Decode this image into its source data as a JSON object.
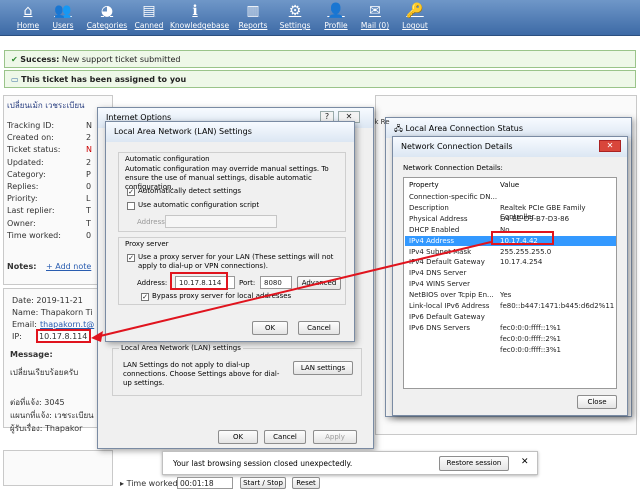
{
  "nav": [
    {
      "label": "Home",
      "icon": "home-icon",
      "glyph": "⌂"
    },
    {
      "label": "Users",
      "icon": "users-icon",
      "glyph": "👥"
    },
    {
      "label": "Categories",
      "icon": "categories-icon",
      "glyph": "◕"
    },
    {
      "label": "Canned",
      "icon": "canned-icon",
      "glyph": "▤"
    },
    {
      "label": "Knowledgebase",
      "icon": "knowledgebase-icon",
      "glyph": "ℹ"
    },
    {
      "label": "Reports",
      "icon": "reports-icon",
      "glyph": "▥"
    },
    {
      "label": "Settings",
      "icon": "settings-icon",
      "glyph": "⚙"
    },
    {
      "label": "Profile",
      "icon": "profile-icon",
      "glyph": "👤"
    },
    {
      "label": "Mail (0)",
      "icon": "mail-icon",
      "glyph": "✉"
    },
    {
      "label": "Logout",
      "icon": "logout-icon",
      "glyph": "🔑"
    }
  ],
  "success": {
    "prefix": "Success:",
    "text": "New support ticket submitted"
  },
  "assigned": "This ticket has been assigned to you",
  "ticket": {
    "subject": "เปลี่ยนเม้ก เวชระเบียน",
    "labels": [
      "Tracking ID:",
      "Created on:",
      "Ticket status:",
      "Updated:",
      "Category:",
      "Replies:",
      "Priority:",
      "Last replier:",
      "Owner:",
      "Time worked:"
    ],
    "value_initials": [
      "N",
      "2",
      "N",
      "2",
      "P",
      "0",
      "L",
      "T",
      "T",
      "0"
    ],
    "notes_label": "Notes:",
    "add_note": "+ Add note"
  },
  "message": {
    "date": "Date:  2019-11-21",
    "name": "Name:  Thapakorn Ti",
    "email_label": "Email:",
    "email_value": "thapakorn.t@",
    "ip_label": "IP:",
    "ip_value": "10.17.8.114",
    "message_label": "Message:",
    "body": "เปลี่ยนเรียบร้อยครับ",
    "extra1": "ต่อที่แจ้ง:   3045",
    "extra2": "แผนกที่แจ้ง: เวชระเบียน",
    "extra3": "ผู้รับเรื่อง:    Thapakor"
  },
  "internet_options": {
    "title": "Internet Options",
    "ok": "OK",
    "cancel": "Cancel",
    "apply": "Apply",
    "lan_group_title": "Local Area Network (LAN) settings",
    "lan_group_text": "LAN Settings do not apply to dial-up connections. Choose Settings above for dial-up settings.",
    "lan_button": "LAN settings"
  },
  "lan_settings": {
    "title": "Local Area Network (LAN) Settings",
    "auto_group": "Automatic configuration",
    "auto_desc": "Automatic configuration may override manual settings.  To ensure the use of manual settings, disable automatic configuration.",
    "auto_detect": "Automatically detect settings",
    "auto_script": "Use automatic configuration script",
    "address_placeholder": "Address",
    "proxy_group": "Proxy server",
    "proxy_use": "Use a proxy server for your LAN (These settings will not apply to dial-up or VPN connections).",
    "address_label": "Address:",
    "address_value": "10.17.8.114",
    "port_label": "Port:",
    "port_value": "8080",
    "advanced": "Advanced",
    "bypass": "Bypass proxy server for local addresses",
    "ok": "OK",
    "cancel": "Cancel"
  },
  "lac_status": {
    "title": "Local Area Connection Status",
    "fragment": "ink Re"
  },
  "details": {
    "title": "Network Connection Details",
    "header": "Network Connection Details:",
    "col_property": "Property",
    "col_value": "Value",
    "rows": [
      [
        "Connection-specific DN...",
        ""
      ],
      [
        "Description",
        "Realtek PCIe GBE Family Controller"
      ],
      [
        "Physical Address",
        "D4-BE-D9-B7-D3-86"
      ],
      [
        "DHCP Enabled",
        "No"
      ],
      [
        "IPv4 Address",
        "10.17.4.42"
      ],
      [
        "IPv4 Subnet Mask",
        "255.255.255.0"
      ],
      [
        "IPv4 Default Gateway",
        "10.17.4.254"
      ],
      [
        "IPv4 DNS Server",
        ""
      ],
      [
        "IPv4 WINS Server",
        ""
      ],
      [
        "NetBIOS over Tcpip En...",
        "Yes"
      ],
      [
        "Link-local IPv6 Address",
        "fe80::b447:1471:b445:d6d2%11"
      ],
      [
        "IPv6 Default Gateway",
        ""
      ],
      [
        "IPv6 DNS Servers",
        "fec0:0:0:ffff::1%1"
      ],
      [
        "",
        "fec0:0:0:ffff::2%1"
      ],
      [
        "",
        "fec0:0:0:ffff::3%1"
      ]
    ],
    "close": "Close"
  },
  "bottom": {
    "session_text": "Your last browsing session closed unexpectedly.",
    "restore": "Restore session",
    "time_worked_label": "Time worked",
    "time_value": "00:01:18",
    "start_stop": "Start / Stop",
    "reset": "Reset"
  },
  "colors": {
    "annotation_red": "#e0141e",
    "selection_blue": "#3399ff",
    "nav_blue": "#4a76b0"
  }
}
